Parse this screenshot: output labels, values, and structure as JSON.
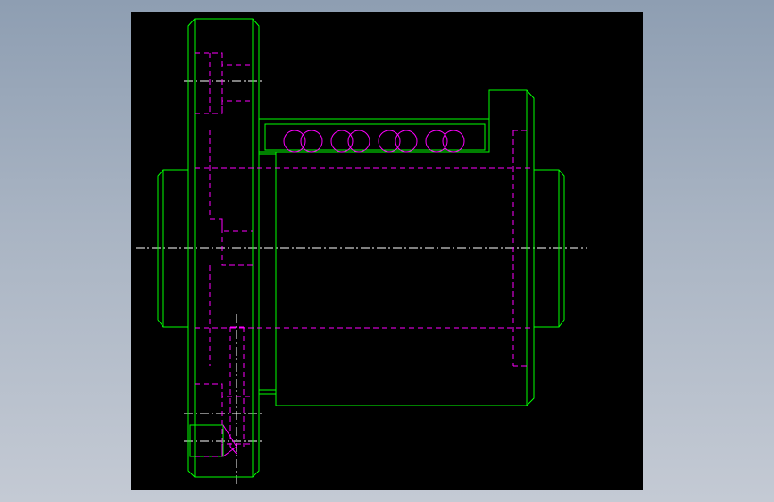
{
  "viewer": {
    "background_top": "#8e9eb2",
    "background_bottom": "#c4cad4",
    "viewport_color": "#000000"
  },
  "drawing": {
    "view": "side-elevation",
    "subject": "ball-screw-nut-with-flange",
    "colors": {
      "visible_edges": "#00ff00",
      "hidden_edges": "#ff00ff",
      "ball_circuit": "#ff00ff",
      "center_lines": "#ffffff"
    }
  }
}
